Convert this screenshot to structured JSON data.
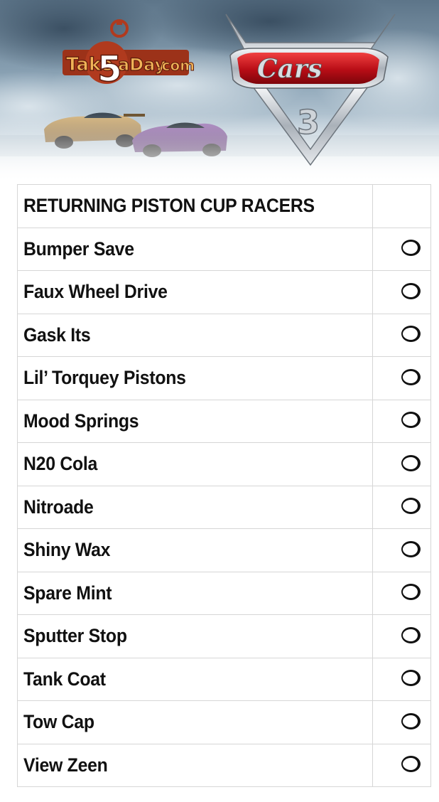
{
  "branding": {
    "site_logo": {
      "part1": "Take",
      "digit": "5",
      "part2": "aDay",
      "part3": ".com"
    },
    "product_logo": {
      "wordmark": "Cars",
      "number": "3"
    }
  },
  "checklist": {
    "header": "RETURNING PISTON CUP RACERS",
    "items": [
      {
        "name": "Bumper Save",
        "checked": false
      },
      {
        "name": "Faux Wheel Drive",
        "checked": false
      },
      {
        "name": "Gask Its",
        "checked": false
      },
      {
        "name": "Lil’ Torquey Pistons",
        "checked": false
      },
      {
        "name": "Mood Springs",
        "checked": false
      },
      {
        "name": "N20 Cola",
        "checked": false
      },
      {
        "name": "Nitroade",
        "checked": false
      },
      {
        "name": "Shiny Wax",
        "checked": false
      },
      {
        "name": "Spare Mint",
        "checked": false
      },
      {
        "name": "Sputter Stop",
        "checked": false
      },
      {
        "name": "Tank Coat",
        "checked": false
      },
      {
        "name": "Tow Cap",
        "checked": false
      },
      {
        "name": "View Zeen",
        "checked": false
      }
    ]
  },
  "colors": {
    "logo_orange": "#e0812a",
    "logo_badge": "#b03a1e",
    "cars_red": "#c8141c",
    "chrome": "#c9cdd2"
  }
}
